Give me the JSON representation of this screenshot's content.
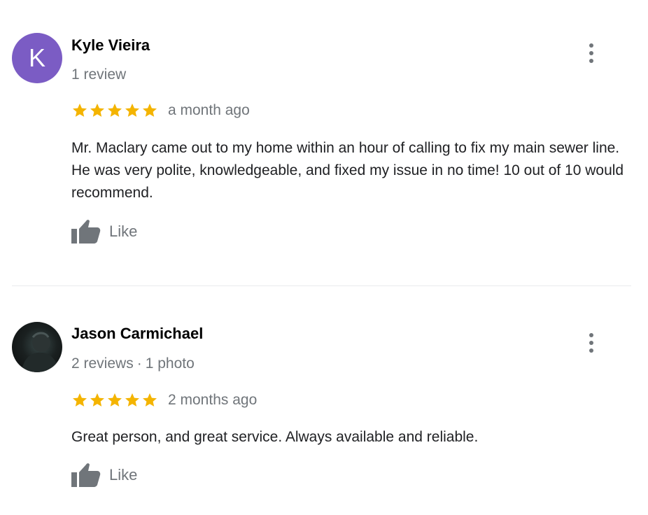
{
  "colors": {
    "star": "#f4b400",
    "secondary_text": "#70757a",
    "avatar_k": "#7b5cc4",
    "divider": "#e8eaed"
  },
  "reviews": [
    {
      "author": "Kyle Vieira",
      "avatar_letter": "K",
      "meta": "1 review",
      "meta_extra": "",
      "rating": 5,
      "date": "a month ago",
      "text": "Mr. Maclary came out to my home within an hour of calling to fix my main sewer line. He was very polite, knowledgeable, and fixed my issue in no time! 10 out of 10 would recommend.",
      "like_label": "Like",
      "more_icon": "more-vert-icon",
      "like_icon": "thumbs-up-icon"
    },
    {
      "author": "Jason Carmichael",
      "avatar_letter": "",
      "meta": "2 reviews",
      "meta_extra": "1 photo",
      "rating": 5,
      "date": "2 months ago",
      "text": "Great person, and great service. Always available and reliable.",
      "like_label": "Like",
      "more_icon": "more-vert-icon",
      "like_icon": "thumbs-up-icon"
    }
  ]
}
